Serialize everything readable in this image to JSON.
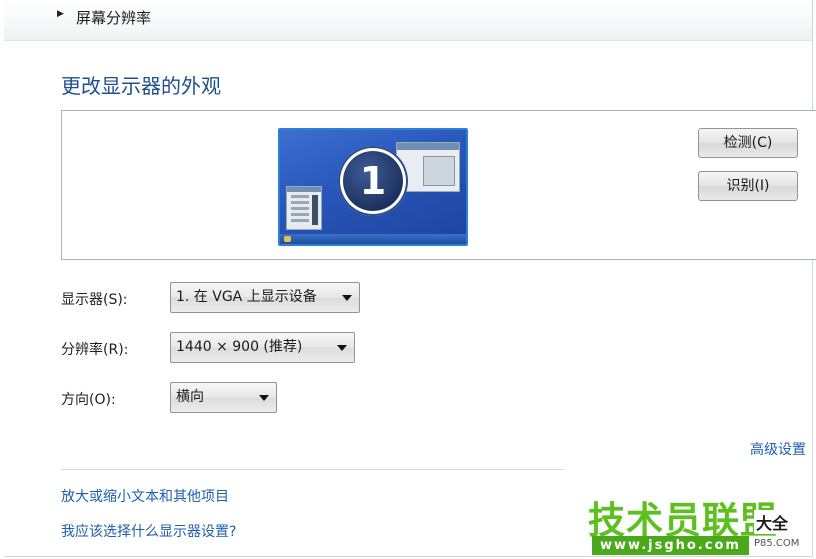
{
  "breadcrumb": {
    "arrow": "▶",
    "label": "屏幕分辨率"
  },
  "page_title": "更改显示器的外观",
  "preview": {
    "monitor_number": "1"
  },
  "buttons": {
    "detect": "检测(C)",
    "identify": "识别(I)"
  },
  "settings": {
    "display": {
      "label": "显示器(S):",
      "value": "1. 在 VGA 上显示设备"
    },
    "resolution": {
      "label": "分辨率(R):",
      "value": "1440 × 900 (推荐)"
    },
    "orientation": {
      "label": "方向(O):",
      "value": "横向"
    }
  },
  "advanced_link": "高级设置",
  "links": {
    "text_size": "放大或缩小文本和其他项目",
    "which_settings": "我应该选择什么显示器设置?"
  },
  "watermark": {
    "title": "技术员联盟",
    "subtitle": "大全",
    "url": "www.jsgho.com",
    "tag": "P85.COM"
  },
  "colors": {
    "title_blue": "#1f4f8f",
    "link_blue": "#1f5fae",
    "watermark_green": "#5cc01e"
  }
}
